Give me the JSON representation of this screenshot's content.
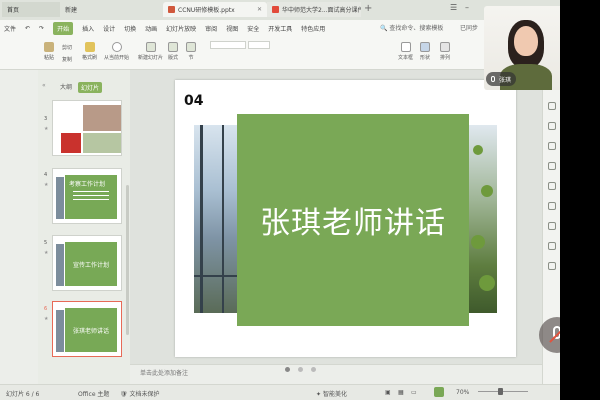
{
  "title_tabs": [
    {
      "label": "首页"
    },
    {
      "label": "新建"
    },
    {
      "label": "CCNU研修模板.pptx",
      "file_type": "ppt"
    },
    {
      "label": "华中师范大学2...面试高分课件参考",
      "file_type": "pdf"
    }
  ],
  "menu": {
    "file": "文件",
    "items": [
      "开始",
      "插入",
      "设计",
      "切换",
      "动画",
      "幻灯片放映",
      "审阅",
      "视图",
      "安全",
      "开发工具",
      "特色应用"
    ],
    "active": "开始",
    "search_placeholder": "查找命令、搜索模板",
    "right_links": "已同步"
  },
  "toolbar": {
    "paste": "粘贴",
    "copy": "复制",
    "cut": "剪切",
    "format_painter": "格式刷",
    "play_from_current": "从当前开始",
    "new_slide": "新建幻灯片",
    "layout": "版式",
    "section": "节",
    "textbox": "文本框",
    "shape": "形状",
    "arrange": "排列"
  },
  "left_panel": {
    "tab_outline": "大纲",
    "tab_slides": "幻灯片",
    "active_tab": "幻灯片",
    "thumbnails": [
      {
        "index": "3",
        "title": ""
      },
      {
        "index": "4",
        "title": "考察工作计划"
      },
      {
        "index": "5",
        "title": "宣传工作计划"
      },
      {
        "index": "6",
        "title": "张琪老师讲话",
        "selected": true
      }
    ]
  },
  "slide": {
    "number": "04",
    "title": "张琪老师讲话",
    "accent_color": "#7aa856"
  },
  "notes_placeholder": "单击此处添加备注",
  "status_bar": {
    "slide_count": "幻灯片 6 / 6",
    "theme": "Office 主题",
    "protection": "文档未保护",
    "smart_beautify": "智能美化",
    "zoom": "70%"
  },
  "video": {
    "participant_name": "张琪"
  },
  "colors": {
    "brand_green": "#8ab35e",
    "slide_green": "#7aa856",
    "mute_slash": "#e2533e"
  }
}
